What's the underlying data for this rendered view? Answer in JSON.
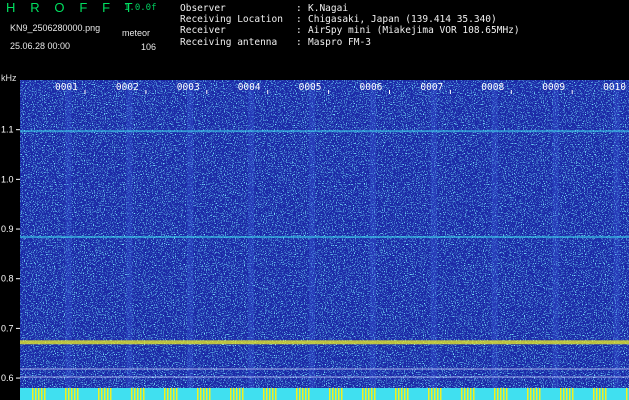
{
  "header": {
    "app_title": "H R O F F T",
    "version": "1.0.0f",
    "filename": "KN9_2506280000.png",
    "mode": "meteor",
    "timestamp": "25.06.28 00:00",
    "count": "106"
  },
  "info_rows": [
    {
      "key": "Observer",
      "value": "K.Nagai"
    },
    {
      "key": "Receiving Location",
      "value": "Chigasaki, Japan (139.414 35.340)"
    },
    {
      "key": "Receiver",
      "value": "AirSpy mini (Miakejima VOR 108.65MHz)"
    },
    {
      "key": "Receiving antenna",
      "value": "Maspro FM-3"
    }
  ],
  "colors": {
    "background": "#000000",
    "spectrogram_base": "#1c2aa8",
    "title_green": "#00e060",
    "info_text": "#f0f0f0",
    "signal_cyan": "#40e0f0",
    "signal_yellow": "#f0f020"
  },
  "chart_data": {
    "type": "heatmap",
    "y_unit": "kHz",
    "y_ticks": [
      "1.1",
      "1.0",
      "0.9",
      "0.8",
      "0.7",
      "0.6"
    ],
    "ylim": [
      0.58,
      1.2
    ],
    "x_ticks": [
      "0001",
      "0002",
      "0003",
      "0004",
      "0005",
      "0006",
      "0007",
      "0008",
      "0009",
      "0010"
    ],
    "horizontal_lines_khz": [
      1.097,
      0.884,
      0.672
    ],
    "grid": false
  }
}
